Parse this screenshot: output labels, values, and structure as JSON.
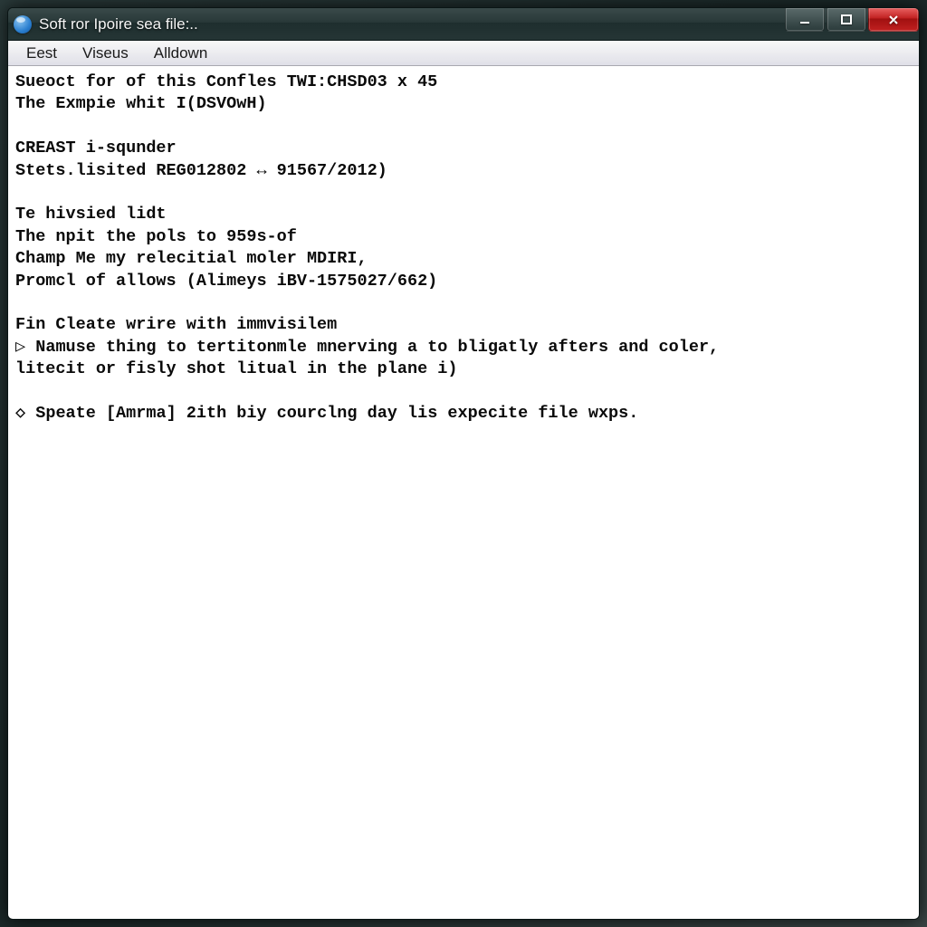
{
  "window": {
    "title": "Soft ror Ipoire sea file:.."
  },
  "menubar": {
    "items": [
      "Eest",
      "Viseus",
      "Alldown"
    ]
  },
  "content": {
    "lines": [
      "Sueoct for of this Confles TWI:CHSD03 x 45",
      "The Exmpie whit I(DSVOwH)",
      "",
      "CREAST i-squnder",
      "Stets.lisited REG012802 ↔ 91567/2012)",
      "",
      "Te hivsied lidt",
      "The npit the pols to 959s-of",
      "Champ Me my relecitial moler MDIRI,",
      "Promcl of allows (Alimeys iBV-1575027/662)",
      "",
      "Fin Cleate wrire with immvisilem",
      "▷ Namuse thing to tertitonmle mnerving a to bligatly afters and coler,",
      "litecit or fisly shot litual in the plane i)",
      "",
      "◇ Speate [Amrma] 2ith biy courclng day lis expecite file wxps."
    ]
  }
}
